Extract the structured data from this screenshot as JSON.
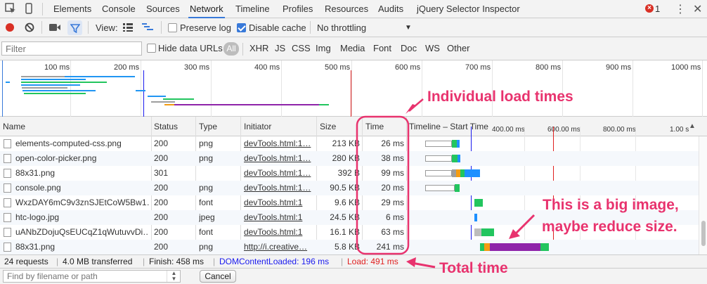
{
  "tabs": {
    "items": [
      "Elements",
      "Console",
      "Sources",
      "Network",
      "Timeline",
      "Profiles",
      "Resources",
      "Audits",
      "jQuery Selector Inspector"
    ],
    "error_count": "1"
  },
  "toolbar": {
    "view_label": "View:",
    "preserve_log": "Preserve log",
    "disable_cache": "Disable cache",
    "throttling": "No throttling"
  },
  "filter": {
    "placeholder": "Filter",
    "hide_data_urls": "Hide data URLs",
    "all": "All",
    "types": [
      "XHR",
      "JS",
      "CSS",
      "Img",
      "Media",
      "Font",
      "Doc",
      "WS",
      "Other"
    ]
  },
  "overview": {
    "ticks": [
      "100 ms",
      "200 ms",
      "300 ms",
      "400 ms",
      "500 ms",
      "600 ms",
      "700 ms",
      "800 ms",
      "900 ms",
      "1000 ms"
    ]
  },
  "grid": {
    "headers": {
      "name": "Name",
      "status": "Status",
      "type": "Type",
      "initiator": "Initiator",
      "size": "Size",
      "time": "Time",
      "timeline": "Timeline – Start Time"
    },
    "timeline_ticks": [
      "400.00 ms",
      "600.00 ms",
      "800.00 ms",
      "1.00 s"
    ],
    "rows": [
      {
        "name": "elements-computed-css.png",
        "status": "200",
        "type": "png",
        "initiator": "devTools.html:1…",
        "size": "213 KB",
        "time": "26 ms"
      },
      {
        "name": "open-color-picker.png",
        "status": "200",
        "type": "png",
        "initiator": "devTools.html:1…",
        "size": "280 KB",
        "time": "38 ms"
      },
      {
        "name": "88x31.png",
        "status": "301",
        "type": "",
        "initiator": "devTools.html:1…",
        "size": "392 B",
        "time": "99 ms"
      },
      {
        "name": "console.png",
        "status": "200",
        "type": "png",
        "initiator": "devTools.html:1…",
        "size": "90.5 KB",
        "time": "20 ms"
      },
      {
        "name": "WxzDAY6mC9v3znSJEtCoW5Bw1…",
        "status": "200",
        "type": "font",
        "initiator": "devTools.html:1",
        "size": "9.6 KB",
        "time": "29 ms"
      },
      {
        "name": "htc-logo.jpg",
        "status": "200",
        "type": "jpeg",
        "initiator": "devTools.html:1",
        "size": "24.5 KB",
        "time": "6 ms"
      },
      {
        "name": "uANbZDojuQsEUCqZ1qWutuvvDi…",
        "status": "200",
        "type": "font",
        "initiator": "devTools.html:1",
        "size": "16.1 KB",
        "time": "63 ms"
      },
      {
        "name": "88x31.png",
        "status": "200",
        "type": "png",
        "initiator": "http://i.creative…",
        "size": "5.8 KB",
        "time": "241 ms"
      }
    ]
  },
  "status": {
    "requests": "24 requests",
    "transferred": "4.0 MB transferred",
    "finish": "Finish: 458 ms",
    "dcl": "DOMContentLoaded: 196 ms",
    "load": "Load: 491 ms"
  },
  "find": {
    "placeholder": "Find by filename or path",
    "cancel": "Cancel"
  },
  "annotations": {
    "individual": "Individual load times",
    "big_image_1": "This is a big image,",
    "big_image_2": "maybe reduce size.",
    "total": "Total time"
  },
  "colors": {
    "accent": "#3879d9",
    "annotation": "#e8336e",
    "dcl": "#1a1aee",
    "load": "#e02020",
    "record": "#d93025",
    "wait_green": "#22c55e",
    "download_blue": "#1e90ff",
    "purple": "#8e24aa",
    "orange": "#f39c12"
  }
}
